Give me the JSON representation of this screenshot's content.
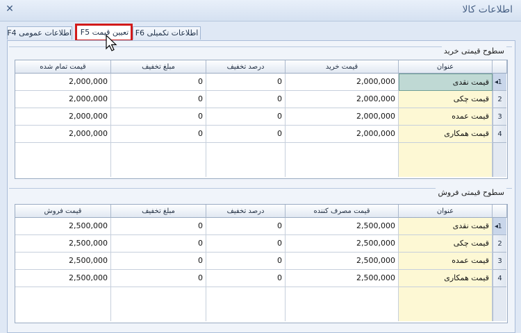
{
  "window": {
    "title": "اطلاعات کالا"
  },
  "tabs": [
    {
      "label": "اطلاعات عمومی F4"
    },
    {
      "label": "تعیین قیمت F5"
    },
    {
      "label": "اطلاعات تکمیلی F6"
    }
  ],
  "purchase": {
    "group_title": "سطوح قیمتی خرید",
    "headers": {
      "title": "عنوان",
      "price": "قیمت خرید",
      "discount_percent": "درصد تخفیف",
      "discount_amount": "مبلغ تخفیف",
      "total": "قیمت تمام شده"
    },
    "rows": [
      {
        "num": "1",
        "title": "قیمت نقدی",
        "price": "2,000,000",
        "discount_percent": "0",
        "discount_amount": "0",
        "total": "2,000,000"
      },
      {
        "num": "2",
        "title": "قیمت چکی",
        "price": "2,000,000",
        "discount_percent": "0",
        "discount_amount": "0",
        "total": "2,000,000"
      },
      {
        "num": "3",
        "title": "قیمت عمده",
        "price": "2,000,000",
        "discount_percent": "0",
        "discount_amount": "0",
        "total": "2,000,000"
      },
      {
        "num": "4",
        "title": "قیمت همکاری",
        "price": "2,000,000",
        "discount_percent": "0",
        "discount_amount": "0",
        "total": "2,000,000"
      }
    ]
  },
  "sales": {
    "group_title": "سطوح قیمتی فروش",
    "headers": {
      "title": "عنوان",
      "price": "قیمت مصرف کننده",
      "discount_percent": "درصد تخفیف",
      "discount_amount": "مبلغ تخفیف",
      "total": "قیمت فروش"
    },
    "rows": [
      {
        "num": "1",
        "title": "قیمت نقدی",
        "price": "2,500,000",
        "discount_percent": "0",
        "discount_amount": "0",
        "total": "2,500,000"
      },
      {
        "num": "2",
        "title": "قیمت چکی",
        "price": "2,500,000",
        "discount_percent": "0",
        "discount_amount": "0",
        "total": "2,500,000"
      },
      {
        "num": "3",
        "title": "قیمت عمده",
        "price": "2,500,000",
        "discount_percent": "0",
        "discount_amount": "0",
        "total": "2,500,000"
      },
      {
        "num": "4",
        "title": "قیمت همکاری",
        "price": "2,500,000",
        "discount_percent": "0",
        "discount_amount": "0",
        "total": "2,500,000"
      }
    ]
  },
  "colors": {
    "highlight": "#d21a1a",
    "selected_cell": "#bfd9d4",
    "title_column": "#fdf8d4"
  }
}
